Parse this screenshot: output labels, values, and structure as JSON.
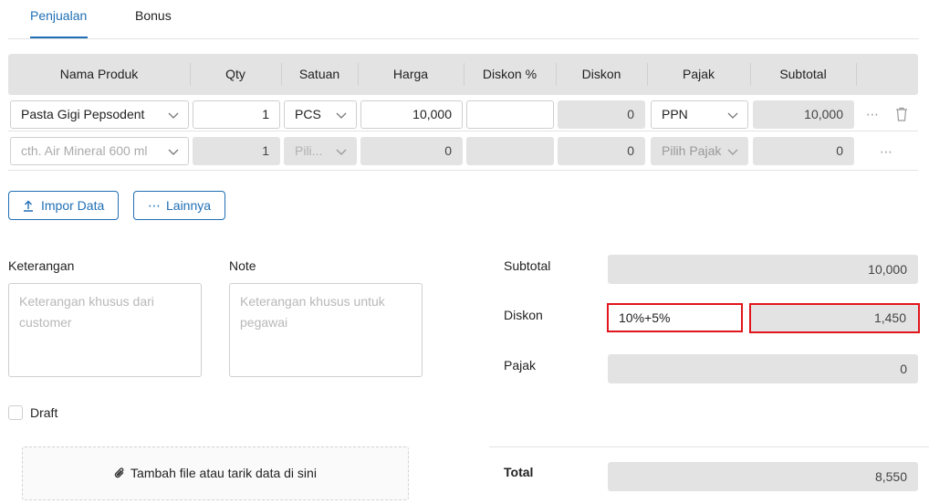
{
  "tabs": [
    {
      "label": "Penjualan",
      "active": true
    },
    {
      "label": "Bonus",
      "active": false
    }
  ],
  "table": {
    "columns": [
      "Nama Produk",
      "Qty",
      "Satuan",
      "Harga",
      "Diskon %",
      "Diskon",
      "Pajak",
      "Subtotal"
    ],
    "rows": [
      {
        "product": "Pasta Gigi Pepsodent",
        "qty": "1",
        "unit": "PCS",
        "price": "10,000",
        "discount_pct": "",
        "discount": "0",
        "tax": "PPN",
        "subtotal": "10,000"
      },
      {
        "product_placeholder": "cth. Air Mineral 600 ml",
        "qty": "1",
        "unit_placeholder": "Pili...",
        "price": "0",
        "discount_pct": "",
        "discount": "0",
        "tax_placeholder": "Pilih Pajak",
        "subtotal": "0"
      }
    ]
  },
  "buttons": {
    "import_label": "Impor Data",
    "more_label": "Lainnya"
  },
  "notes": {
    "keterangan_label": "Keterangan",
    "keterangan_placeholder": "Keterangan khusus dari customer",
    "note_label": "Note",
    "note_placeholder": "Keterangan khusus untuk pegawai"
  },
  "draft_label": "Draft",
  "attach_label": "Tambah file atau tarik data di sini",
  "summary": {
    "subtotal_label": "Subtotal",
    "subtotal_value": "10,000",
    "discount_label": "Diskon",
    "discount_input": "10%+5%",
    "discount_value": "1,450",
    "tax_label": "Pajak",
    "tax_value": "0",
    "total_label": "Total",
    "total_value": "8,550"
  },
  "colors": {
    "accent": "#1f6fb5",
    "highlight": "#e0161c",
    "disabled_bg": "#e3e3e3"
  }
}
